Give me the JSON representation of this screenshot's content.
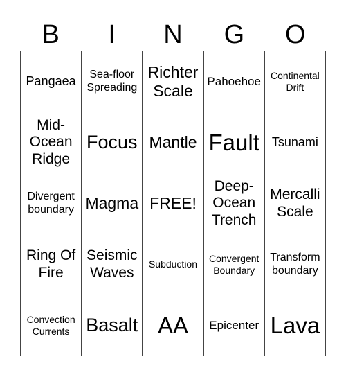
{
  "header": [
    "B",
    "I",
    "N",
    "G",
    "O"
  ],
  "cells": [
    [
      "Pangaea",
      "Sea-floor Spreading",
      "Richter Scale",
      "Pahoehoe",
      "Continental Drift"
    ],
    [
      "Mid- Ocean Ridge",
      "Focus",
      "Mantle",
      "Fault",
      "Tsunami"
    ],
    [
      "Divergent boundary",
      "Magma",
      "FREE!",
      "Deep- Ocean Trench",
      "Mercalli Scale"
    ],
    [
      "Ring Of Fire",
      "Seismic Waves",
      "Subduction",
      "Convergent Boundary",
      "Transform boundary"
    ],
    [
      "Convection Currents",
      "Basalt",
      "AA",
      "Epicenter",
      "Lava"
    ]
  ]
}
